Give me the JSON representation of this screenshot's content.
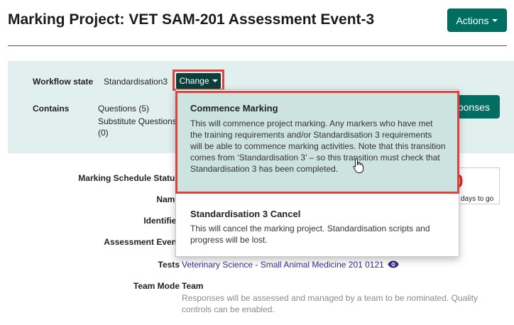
{
  "page": {
    "title": "Marking Project: VET SAM-201 Assessment Event-3",
    "actions_label": "Actions"
  },
  "workflow": {
    "state_label": "Workflow state",
    "state_value": "Standardisation3",
    "change_label": "Change",
    "contains_label": "Contains",
    "contains_items": [
      "Questions (5)",
      "Substitute Questions",
      "(0)"
    ],
    "responses_label": "ponses"
  },
  "fields": {
    "schedule_status_label": "Marking Schedule Status",
    "name_label": "Name",
    "identifier_label": "Identifier",
    "assessment_event_label": "Assessment Event",
    "tests_label": "Tests",
    "tests_value": "Veterinary Science - Small Animal Medicine 201 0121",
    "team_mode_label": "Team Mode",
    "team_mode_value": "Team",
    "team_mode_desc": "Responses will be assessed and managed by a team to be nominated. Quality controls can be enabled.",
    "status_partial_glyph": "0",
    "days_to_go": "days to go"
  },
  "dropdown": {
    "options": [
      {
        "title": "Commence Marking",
        "description": "This will commence project marking. Any markers who have met the training requirements and/or Standardisation 3 requirements will be able to commence marking activities. Note that this transition comes from ‘Standardisation 3’ – so this transition must check that Standardisation 3 has been completed."
      },
      {
        "title": "Standardisation 3 Cancel",
        "description": "This will cancel the marking project. Standardisation scripts and progress will be lost."
      }
    ]
  },
  "colors": {
    "accent": "#006e63",
    "panel": "#e1efee",
    "highlight_outline": "#e0413a",
    "selected_option": "#cde3df",
    "link": "#3b2a84"
  },
  "icons": [
    "caret-down-icon",
    "eye-icon",
    "hand-pointer-icon"
  ]
}
